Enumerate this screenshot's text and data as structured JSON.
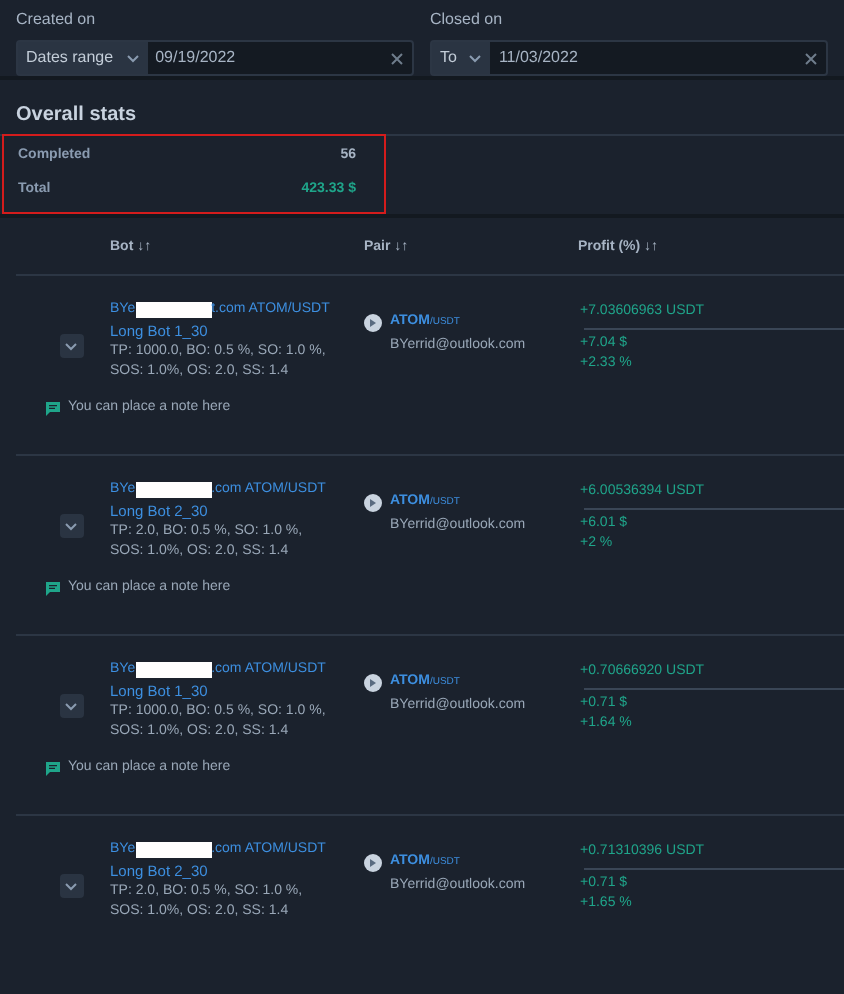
{
  "filters": [
    {
      "label": "Created on",
      "mode": "Dates range",
      "value": "09/19/2022"
    },
    {
      "label": "Closed on",
      "mode": "To",
      "value": "11/03/2022"
    }
  ],
  "overall_stats": {
    "title": "Overall stats",
    "highlighted": true,
    "rows": [
      {
        "label": "Completed",
        "value": "56",
        "kind": "plain"
      },
      {
        "label": "Total",
        "value": "423.33 $",
        "kind": "profit"
      }
    ]
  },
  "table": {
    "columns": [
      "Bot ↓↑",
      "Pair ↓↑",
      "Profit (%) ↓↑"
    ],
    "rows": [
      {
        "bot_prefix": "BYe",
        "bot_suffix": "t.com ATOM/USDT",
        "bot_name": "Long Bot 1_30",
        "settings": "TP: 1000.0, BO: 0.5 %, SO: 1.0 %,",
        "settings_2": "SOS: 1.0%, OS: 2.0, SS: 1.4",
        "pair_base": "ATOM",
        "pair_quote": "/USDT",
        "account": "BYerrid@outlook.com",
        "profit_usdt": "+7.03606963 USDT",
        "profit_usd": "+7.04 $",
        "profit_pct": "+2.33 %",
        "note": "You can place a note here"
      },
      {
        "bot_prefix": "BYe",
        "bot_suffix": ".com ATOM/USDT",
        "bot_name": "Long Bot 2_30",
        "settings": "TP: 2.0, BO: 0.5 %, SO: 1.0 %,",
        "settings_2": "SOS: 1.0%, OS: 2.0, SS: 1.4",
        "pair_base": "ATOM",
        "pair_quote": "/USDT",
        "account": "BYerrid@outlook.com",
        "profit_usdt": "+6.00536394 USDT",
        "profit_usd": "+6.01 $",
        "profit_pct": "+2 %",
        "note": "You can place a note here"
      },
      {
        "bot_prefix": "BYe",
        "bot_suffix": ".com ATOM/USDT",
        "bot_name": "Long Bot 1_30",
        "settings": "TP: 1000.0, BO: 0.5 %, SO: 1.0 %,",
        "settings_2": "SOS: 1.0%, OS: 2.0, SS: 1.4",
        "pair_base": "ATOM",
        "pair_quote": "/USDT",
        "account": "BYerrid@outlook.com",
        "profit_usdt": "+0.70666920 USDT",
        "profit_usd": "+0.71 $",
        "profit_pct": "+1.64 %",
        "note": "You can place a note here"
      },
      {
        "bot_prefix": "BYe",
        "bot_suffix": ".com ATOM/USDT",
        "bot_name": "Long Bot 2_30",
        "settings": "TP: 2.0, BO: 0.5 %, SO: 1.0 %,",
        "settings_2": "SOS: 1.0%, OS: 2.0, SS: 1.4",
        "pair_base": "ATOM",
        "pair_quote": "/USDT",
        "account": "BYerrid@outlook.com",
        "profit_usdt": "+0.71310396 USDT",
        "profit_usd": "+0.71 $",
        "profit_pct": "+1.65 %"
      }
    ]
  }
}
